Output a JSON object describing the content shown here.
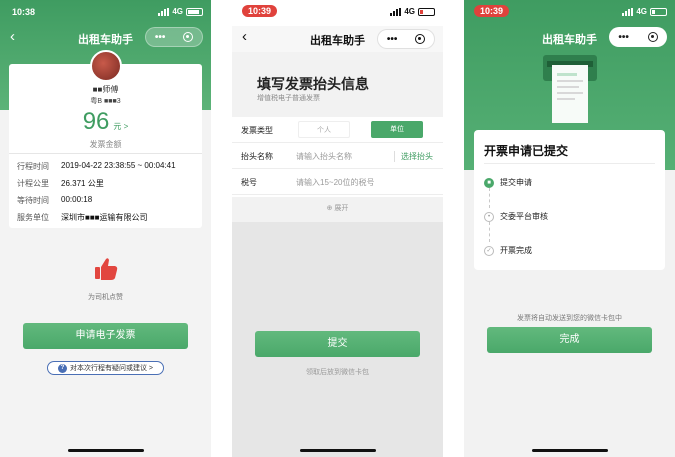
{
  "colors": {
    "accent": "#4aa86a",
    "header_green": "#3f9c61",
    "status_red": "#e0423c"
  },
  "panel1": {
    "status": {
      "time": "10:38",
      "network": "4G"
    },
    "nav": {
      "title": "出租车助手",
      "more": "•••"
    },
    "driver_name": "■■师傅",
    "plate": "粤B ■■■3",
    "amount": "96",
    "amount_unit": "元 >",
    "amount_label": "发票金额",
    "rows": [
      {
        "key": "行程时间",
        "value": "2019-04-22 23:38:55 ~ 00:04:41"
      },
      {
        "key": "计程公里",
        "value": "26.371 公里"
      },
      {
        "key": "等待时间",
        "value": "00:00:18"
      },
      {
        "key": "服务单位",
        "value": "深圳市■■■运输有限公司"
      }
    ],
    "like_label": "为司机点赞",
    "apply_button": "申请电子发票",
    "feedback_icon": "?",
    "feedback": "对本次行程有疑问或建议 >"
  },
  "panel2": {
    "status": {
      "time": "10:39",
      "network": "4G"
    },
    "nav": {
      "title": "出租车助手",
      "more": "•••"
    },
    "form_title": "填写发票抬头信息",
    "form_sub": "增值税电子普通发票",
    "type_label": "发票类型",
    "type_options": [
      "个人",
      "单位"
    ],
    "name_label": "抬头名称",
    "name_placeholder": "请输入抬头名称",
    "choose_label": "选择抬头",
    "tax_label": "税号",
    "tax_placeholder": "请输入15~20位的税号",
    "expand": "展开",
    "submit": "提交",
    "submit_note": "领取后放到微信卡包"
  },
  "panel3": {
    "status": {
      "time": "10:39",
      "network": "4G"
    },
    "nav": {
      "title": "出租车助手",
      "more": "•••"
    },
    "card_title": "开票申请已提交",
    "steps": [
      {
        "label": "提交申请",
        "done": true
      },
      {
        "label": "交委平台审核",
        "done": false
      },
      {
        "label": "开票完成",
        "done": false
      }
    ],
    "note": "发票将自动发送到您的微信卡包中",
    "done_button": "完成"
  }
}
